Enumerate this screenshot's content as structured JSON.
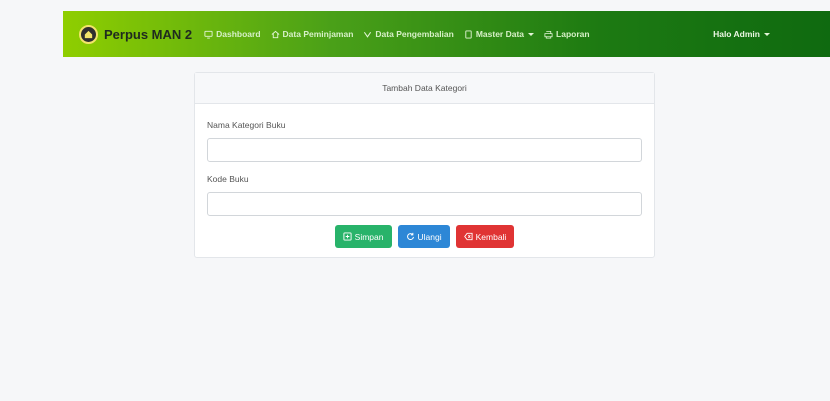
{
  "navbar": {
    "brand": "Perpus MAN 2",
    "links": [
      {
        "label": "Dashboard",
        "icon": "monitor-icon"
      },
      {
        "label": "Data Peminjaman",
        "icon": "home-icon"
      },
      {
        "label": "Data Pengembalian",
        "icon": "chevron-down-icon"
      },
      {
        "label": "Master Data",
        "icon": "book-icon"
      },
      {
        "label": "Laporan",
        "icon": "print-icon"
      }
    ],
    "user": "Halo Admin"
  },
  "form": {
    "title": "Tambah Data Kategori",
    "field1_label": "Nama Kategori Buku",
    "field1_value": "",
    "field2_label": "Kode Buku",
    "field2_value": "",
    "buttons": {
      "save": "Simpan",
      "reset": "Ulangi",
      "back": "Kembali"
    }
  },
  "colors": {
    "nav_start": "#8fce00",
    "nav_end": "#0f6a10",
    "save": "#28b36a",
    "reset": "#2d87d6",
    "back": "#e03434"
  }
}
